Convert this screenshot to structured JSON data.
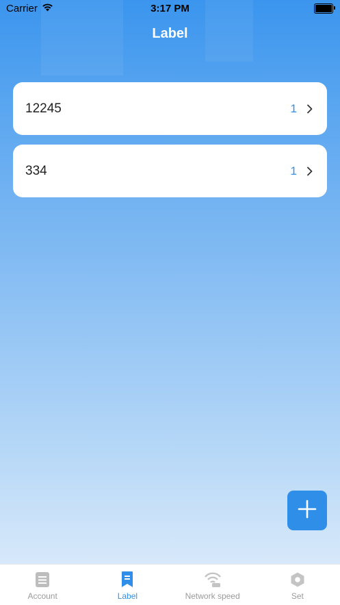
{
  "status_bar": {
    "carrier": "Carrier",
    "time": "3:17 PM"
  },
  "nav": {
    "title": "Label"
  },
  "labels": [
    {
      "name": "12245",
      "count": "1"
    },
    {
      "name": "334",
      "count": "1"
    }
  ],
  "fab": {
    "icon": "plus-icon"
  },
  "tabbar": {
    "tabs": [
      {
        "label": "Account",
        "icon": "document-icon",
        "active": false
      },
      {
        "label": "Label",
        "icon": "bookmark-icon",
        "active": true
      },
      {
        "label": "Network speed",
        "icon": "wifi-speed-icon",
        "active": false
      },
      {
        "label": "Set",
        "icon": "hexagon-settings-icon",
        "active": false
      }
    ]
  },
  "colors": {
    "accent": "#2f8ee8",
    "inactive": "#9a9a9a",
    "background_top": "#3b95ee",
    "background_bottom": "#e3effb"
  }
}
